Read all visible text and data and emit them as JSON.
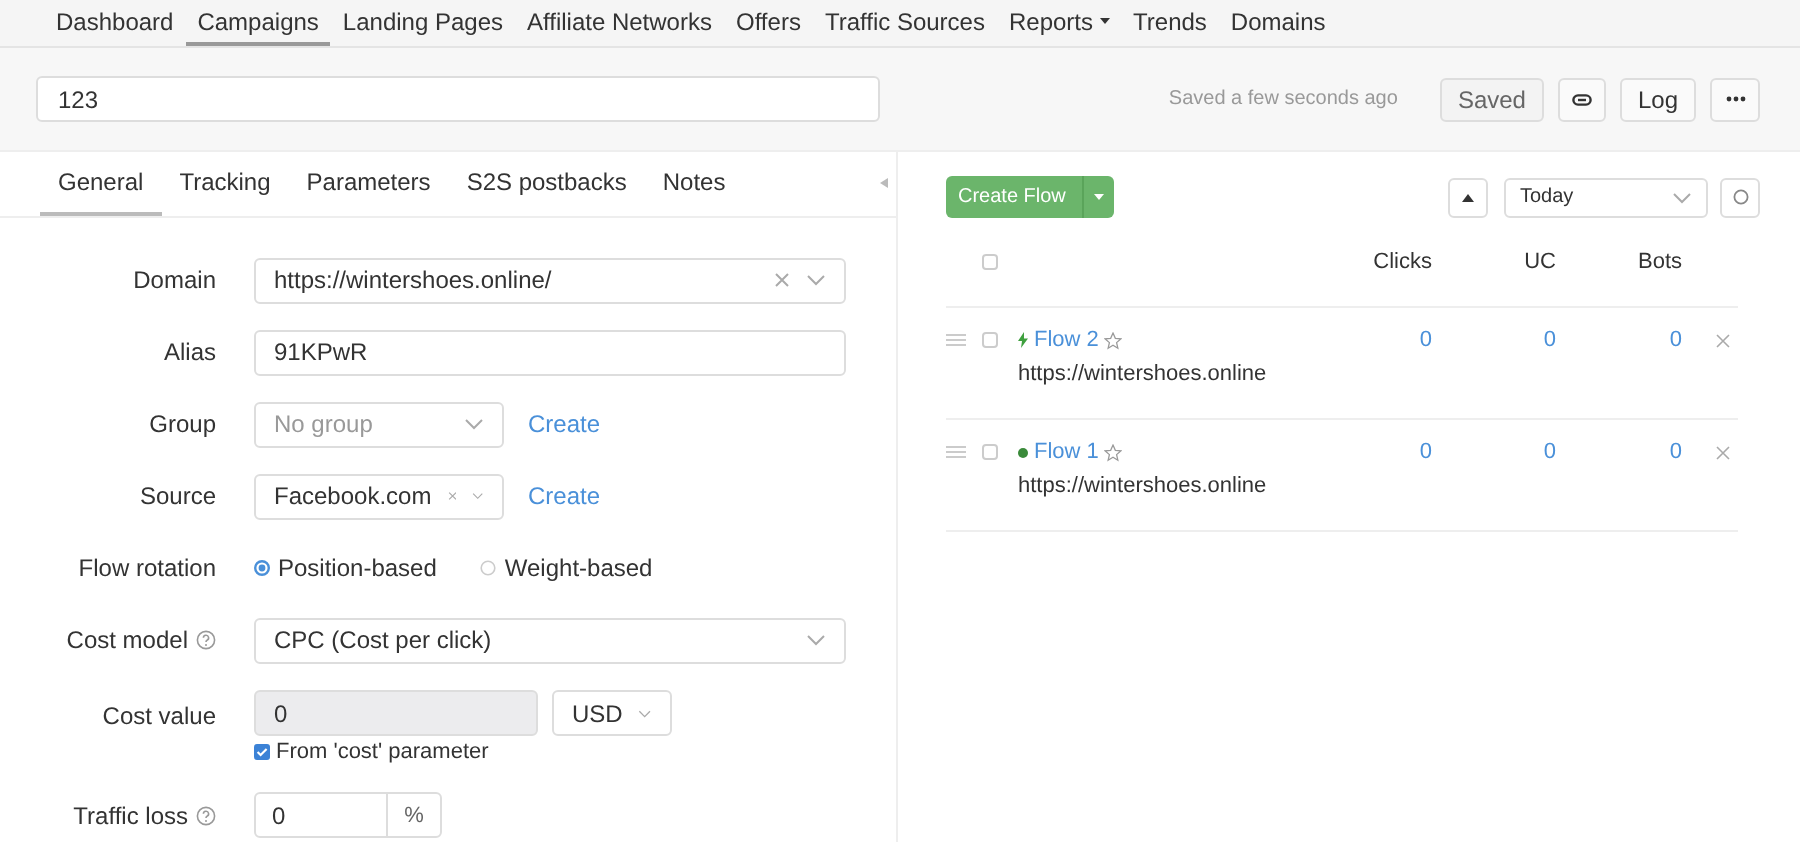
{
  "nav": [
    {
      "label": "Dashboard",
      "selected": false,
      "has_menu": false
    },
    {
      "label": "Campaigns",
      "selected": true,
      "has_menu": false
    },
    {
      "label": "Landing Pages",
      "selected": false,
      "has_menu": false
    },
    {
      "label": "Affiliate Networks",
      "selected": false,
      "has_menu": false
    },
    {
      "label": "Offers",
      "selected": false,
      "has_menu": false
    },
    {
      "label": "Traffic Sources",
      "selected": false,
      "has_menu": false
    },
    {
      "label": "Reports",
      "selected": false,
      "has_menu": true
    },
    {
      "label": "Trends",
      "selected": false,
      "has_menu": false
    },
    {
      "label": "Domains",
      "selected": false,
      "has_menu": false
    }
  ],
  "campaign": {
    "name": "123",
    "status": "Saved a few seconds ago",
    "buttons": [
      {
        "kind": "text",
        "label": "Saved",
        "disabled": true
      },
      {
        "kind": "link"
      },
      {
        "kind": "text",
        "label": "Log",
        "disabled": false
      },
      {
        "kind": "more"
      }
    ]
  },
  "tabs": [
    {
      "label": "General",
      "selected": true
    },
    {
      "label": "Tracking",
      "selected": false
    },
    {
      "label": "Parameters",
      "selected": false
    },
    {
      "label": "S2S postbacks",
      "selected": false
    },
    {
      "label": "Notes",
      "selected": false
    }
  ],
  "form": {
    "fields": [
      {
        "kind": "select",
        "label": "Domain",
        "help": false,
        "value": "https://wintershoes.online/",
        "clearable": true
      },
      {
        "kind": "input",
        "label": "Alias",
        "help": false,
        "value": "91KPwR"
      },
      {
        "kind": "select-create",
        "label": "Group",
        "help": false,
        "placeholder": "No group",
        "clearable": false,
        "action": "Create"
      },
      {
        "kind": "select-create",
        "label": "Source",
        "help": false,
        "value": "Facebook.com",
        "clearable": true,
        "action": "Create"
      },
      {
        "kind": "radio",
        "label": "Flow rotation",
        "help": false,
        "options": [
          {
            "label": "Position-based",
            "selected": true
          },
          {
            "label": "Weight-based",
            "selected": false
          }
        ]
      },
      {
        "kind": "select",
        "label": "Cost model",
        "help": true,
        "value": "CPC (Cost per click)",
        "clearable": false
      },
      {
        "kind": "cost",
        "label": "Cost value",
        "help": false,
        "value": "0",
        "disabled": true,
        "currency": "USD",
        "checkbox": {
          "label": "From 'cost' parameter",
          "checked": true
        }
      },
      {
        "kind": "percent",
        "label": "Traffic loss",
        "help": true,
        "value": "0",
        "unit": "%"
      }
    ]
  },
  "flows": {
    "create_button": "Create Flow",
    "period": "Today",
    "columns": [
      "Clicks",
      "UC",
      "Bots"
    ],
    "all_checked": false,
    "rows": [
      {
        "kind": "bolt",
        "name": "Flow 2",
        "url": "https://wintershoes.online",
        "starred": false,
        "checked": false,
        "values": [
          "0",
          "0",
          "0"
        ]
      },
      {
        "kind": "dot",
        "name": "Flow 1",
        "url": "https://wintershoes.online",
        "starred": false,
        "checked": false,
        "values": [
          "0",
          "0",
          "0"
        ]
      }
    ]
  }
}
